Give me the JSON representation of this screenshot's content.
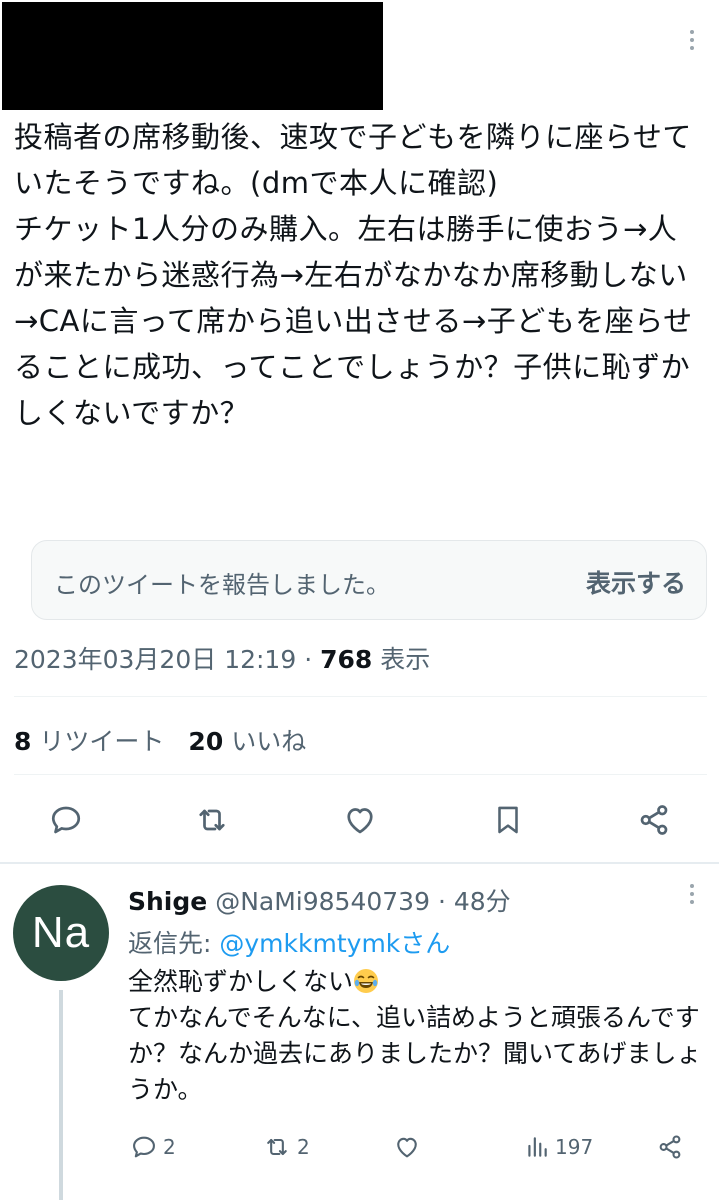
{
  "tweet": {
    "text": "投稿者の席移動後、速攻で子どもを隣りに座らせていたそうですね。(dmで本人に確認)\nチケット1人分のみ購入。左右は勝手に使おう→人が来たから迷惑行為→左右がなかなか席移動しない→CAに言って席から追い出させる→子どもを座らせることに成功、ってことでしょうか？子供に恥ずかしくないですか？",
    "report_notice": "このツイートを報告しました。",
    "report_show": "表示する",
    "timestamp": "2023年03月20日 12:19",
    "separator": "·",
    "views_count": "768",
    "views_label": "表示",
    "retweets_count": "8",
    "retweets_label": "リツイート",
    "likes_count": "20",
    "likes_label": "いいね"
  },
  "icons": [
    "more-icon",
    "reply-icon",
    "retweet-icon",
    "like-icon",
    "bookmark-icon",
    "share-icon",
    "views-icon"
  ],
  "reply": {
    "avatar_text": "Na",
    "avatar_color": "#2b4d40",
    "display_name": "Shige",
    "handle": "@NaMi98540739",
    "separator": "·",
    "time": "48分",
    "reply_to_label": "返信先:",
    "reply_to_user": "@ymkkmtymkさん",
    "body_line1": "全然恥ずかしくない",
    "emoji": "face-with-tears-of-joy",
    "body_rest": "てかなんでそんなに、追い詰めようと頑張るんですか？なんか過去にありましたか？聞いてあげましょうか。",
    "reply_count": "2",
    "retweet_count": "2",
    "view_count": "197"
  },
  "colors": {
    "accent": "#1d9bf0",
    "secondary_text": "#536471",
    "primary_text": "#0f1419"
  }
}
